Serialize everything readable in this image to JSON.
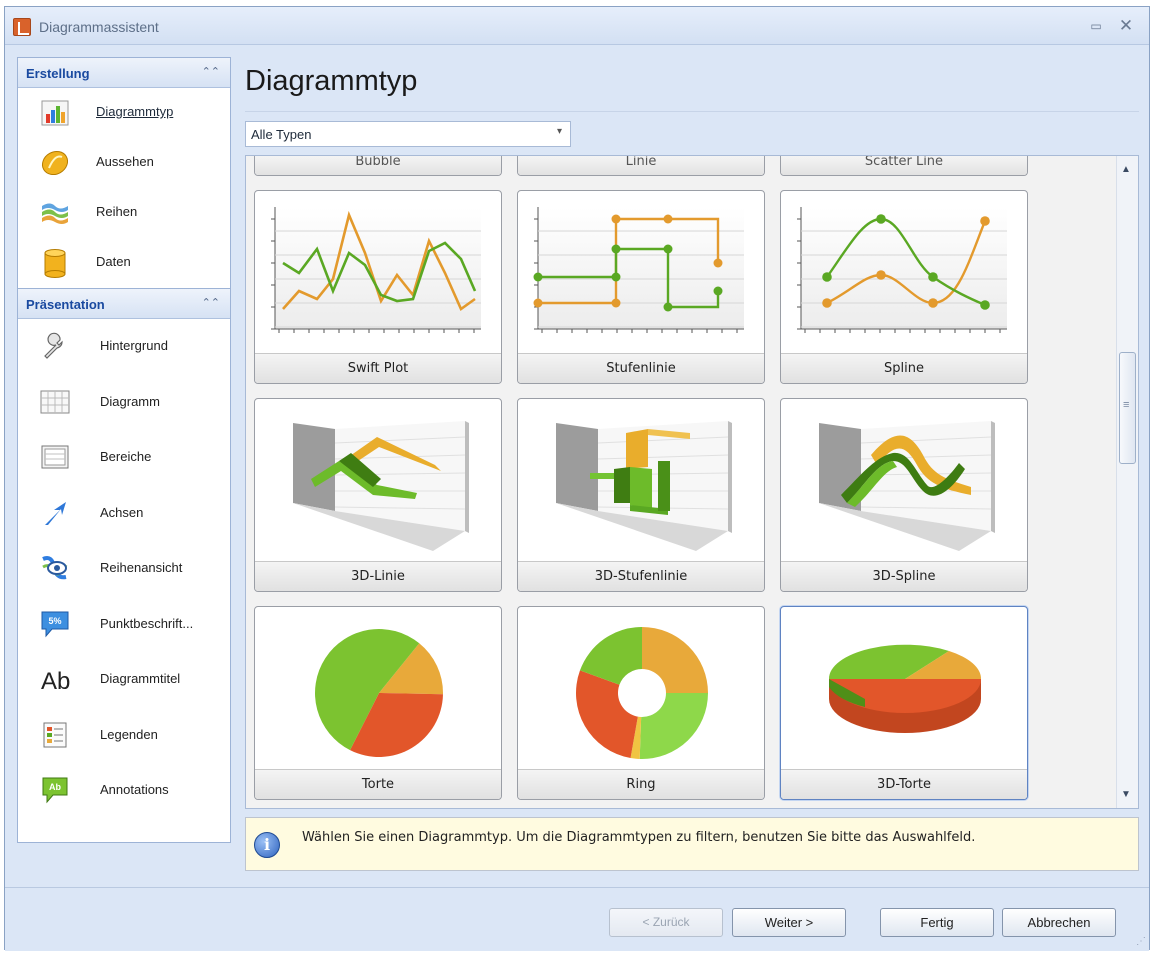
{
  "window": {
    "title": "Diagrammassistent"
  },
  "sidebar": {
    "groups": [
      {
        "title": "Erstellung",
        "items": [
          {
            "label": "Diagrammtyp",
            "icon": "bar-chart-icon",
            "active": true
          },
          {
            "label": "Aussehen",
            "icon": "palette-icon"
          },
          {
            "label": "Reihen",
            "icon": "series-layers-icon"
          },
          {
            "label": "Daten",
            "icon": "database-icon"
          }
        ]
      },
      {
        "title": "Präsentation",
        "items": [
          {
            "label": "Hintergrund",
            "icon": "wrench-icon"
          },
          {
            "label": "Diagramm",
            "icon": "chart-grid-icon"
          },
          {
            "label": "Bereiche",
            "icon": "panes-icon"
          },
          {
            "label": "Achsen",
            "icon": "axis-arrow-icon"
          },
          {
            "label": "Reihenansicht",
            "icon": "series-view-icon"
          },
          {
            "label": "Punktbeschrift...",
            "icon": "point-label-icon",
            "icon_text": "5%"
          },
          {
            "label": "Diagrammtitel",
            "icon": "chart-title-icon",
            "icon_text": "Ab"
          },
          {
            "label": "Legenden",
            "icon": "legend-icon"
          },
          {
            "label": "Annotations",
            "icon": "annotation-icon",
            "icon_text": "Ab"
          }
        ]
      }
    ]
  },
  "main": {
    "title": "Diagrammtyp",
    "filter": {
      "value": "Alle Typen"
    },
    "gallery": {
      "partial_row": [
        "Bubble",
        "Linie",
        "Scatter Line"
      ],
      "tiles": [
        {
          "label": "Swift Plot",
          "kind": "swift"
        },
        {
          "label": "Stufenlinie",
          "kind": "step"
        },
        {
          "label": "Spline",
          "kind": "spline"
        },
        {
          "label": "3D-Linie",
          "kind": "line3d"
        },
        {
          "label": "3D-Stufenlinie",
          "kind": "step3d"
        },
        {
          "label": "3D-Spline",
          "kind": "spline3d"
        },
        {
          "label": "Torte",
          "kind": "pie"
        },
        {
          "label": "Ring",
          "kind": "ring"
        },
        {
          "label": "3D-Torte",
          "kind": "pie3d",
          "selected": true
        }
      ]
    },
    "info": "Wählen Sie einen Diagrammtyp. Um die Diagrammtypen zu filtern, benutzen Sie bitte das Auswahlfeld."
  },
  "footer": {
    "back": "< Zurück",
    "next": "Weiter >",
    "finish": "Fertig",
    "cancel": "Abbrechen"
  },
  "colors": {
    "orange": "#e39a2d",
    "green": "#5aa823",
    "pie_green": "#7cc330",
    "pie_orange": "#e2562a",
    "pie_yellow": "#e8a93a",
    "accent_blue": "#1a4aa0"
  }
}
